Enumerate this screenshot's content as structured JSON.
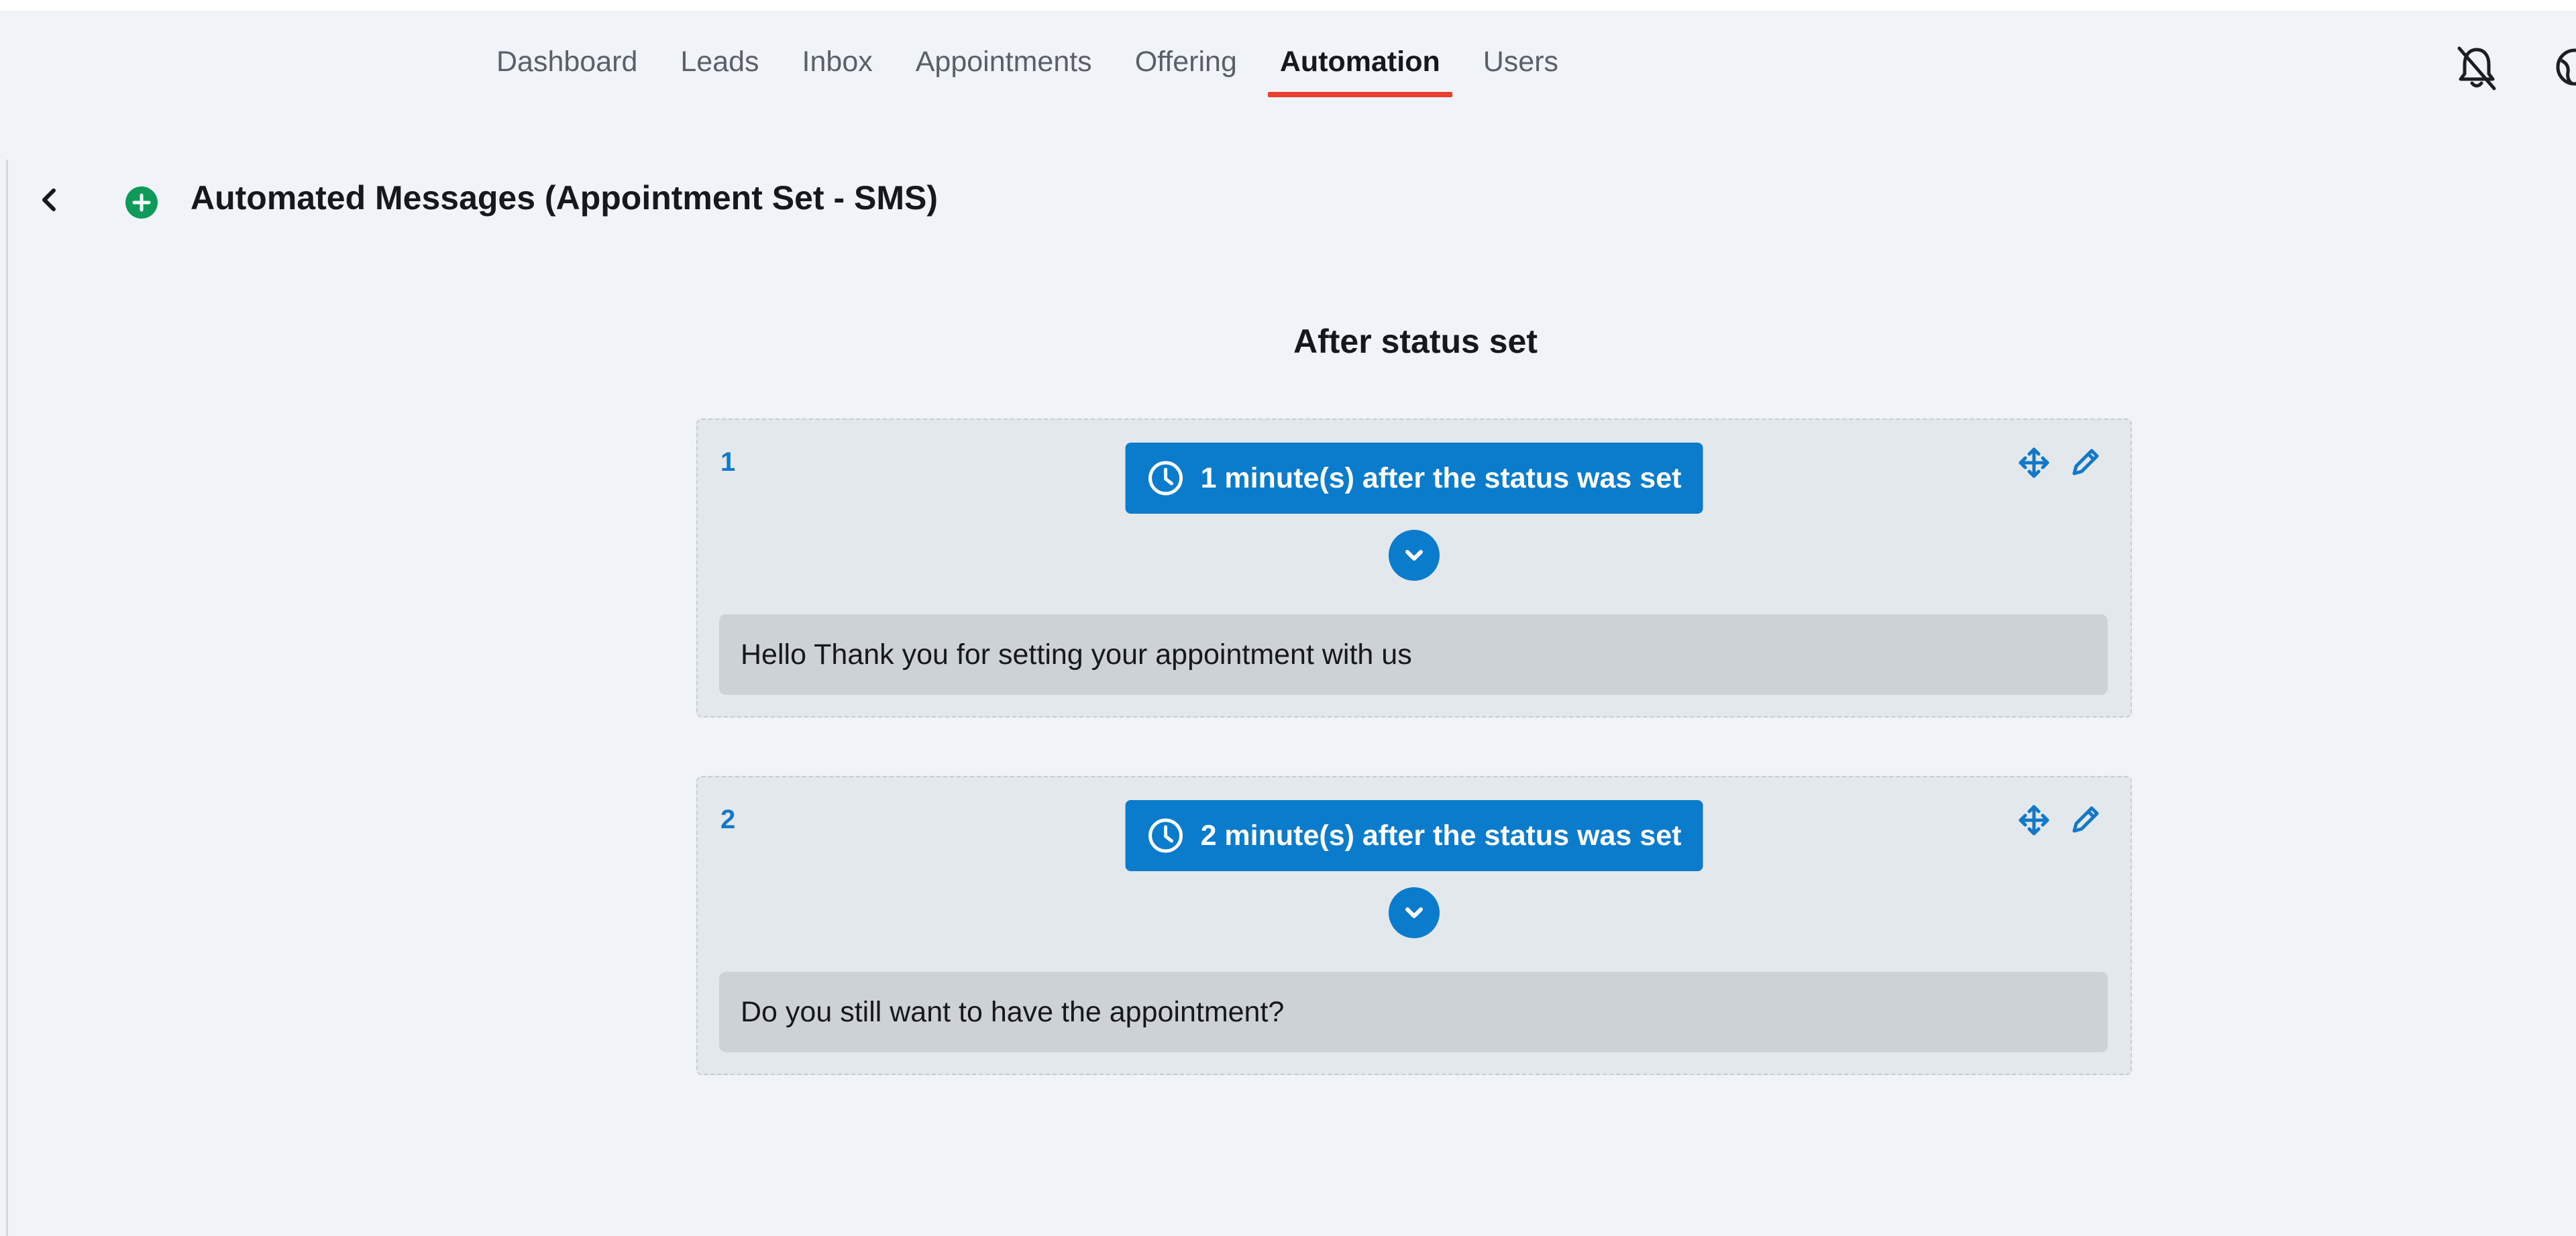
{
  "nav": {
    "items": [
      {
        "label": "Dashboard"
      },
      {
        "label": "Leads"
      },
      {
        "label": "Inbox"
      },
      {
        "label": "Appointments"
      },
      {
        "label": "Offering"
      },
      {
        "label": "Automation",
        "active": true
      },
      {
        "label": "Users"
      }
    ],
    "icons": [
      "bell-off-icon",
      "globe-icon"
    ]
  },
  "header": {
    "title": "Automated Messages (Appointment Set - SMS)",
    "icons": [
      "chevron-left-icon",
      "plus-circle-icon"
    ]
  },
  "section": {
    "title": "After status set"
  },
  "messages": [
    {
      "number": "1",
      "delay": "1 minute(s) after the status was set",
      "text": "Hello Thank you for setting your appointment with us"
    },
    {
      "number": "2",
      "delay": "2 minute(s) after the status was set",
      "text": "Do you still want to have the appointment?"
    }
  ],
  "colors": {
    "accent": "#0b7bcb",
    "active_tab_underline": "#e8412f",
    "add_button": "#0f9a5a",
    "background": "#f0f4f8"
  }
}
